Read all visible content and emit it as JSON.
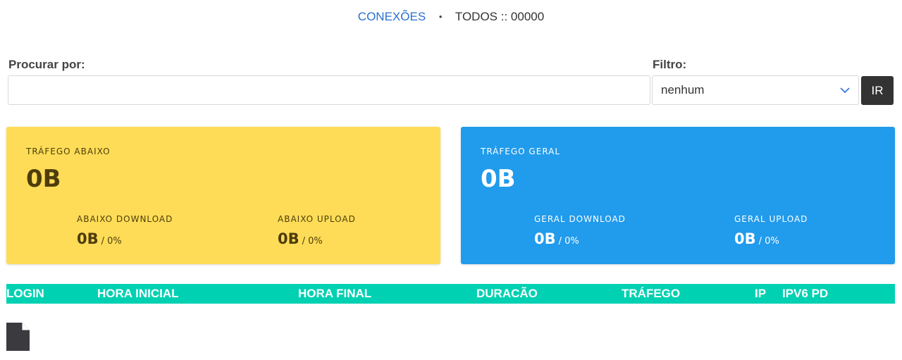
{
  "breadcrumb": {
    "link": "CONEXÕES",
    "separator": "•",
    "current": "TODOS :: 00000"
  },
  "search": {
    "label": "Procurar por:",
    "value": "",
    "placeholder": ""
  },
  "filter": {
    "label": "Filtro:",
    "selected": "nenhum",
    "go_label": "IR"
  },
  "cards": {
    "down": {
      "title": "TRÁFEGO ABAIXO",
      "value": "0B",
      "download": {
        "label": "ABAIXO DOWNLOAD",
        "value": "0B",
        "pct": "/ 0%"
      },
      "upload": {
        "label": "ABAIXO UPLOAD",
        "value": "0B",
        "pct": "/ 0%"
      },
      "color": "#fedc57"
    },
    "total": {
      "title": "TRÁFEGO GERAL",
      "value": "0B",
      "download": {
        "label": "GERAL DOWNLOAD",
        "value": "0B",
        "pct": "/ 0%"
      },
      "upload": {
        "label": "GERAL UPLOAD",
        "value": "0B",
        "pct": "/ 0%"
      },
      "color": "#219bec"
    }
  },
  "table": {
    "columns": [
      "LOGIN",
      "HORA INICIAL",
      "HORA FINAL",
      "DURACÃO",
      "TRÁFEGO",
      "IP",
      "IPV6 PD"
    ],
    "header_color": "#00d1b2",
    "rows": []
  },
  "icons": {
    "filter_chevron": "chevron-down-icon",
    "export": "file-icon"
  }
}
